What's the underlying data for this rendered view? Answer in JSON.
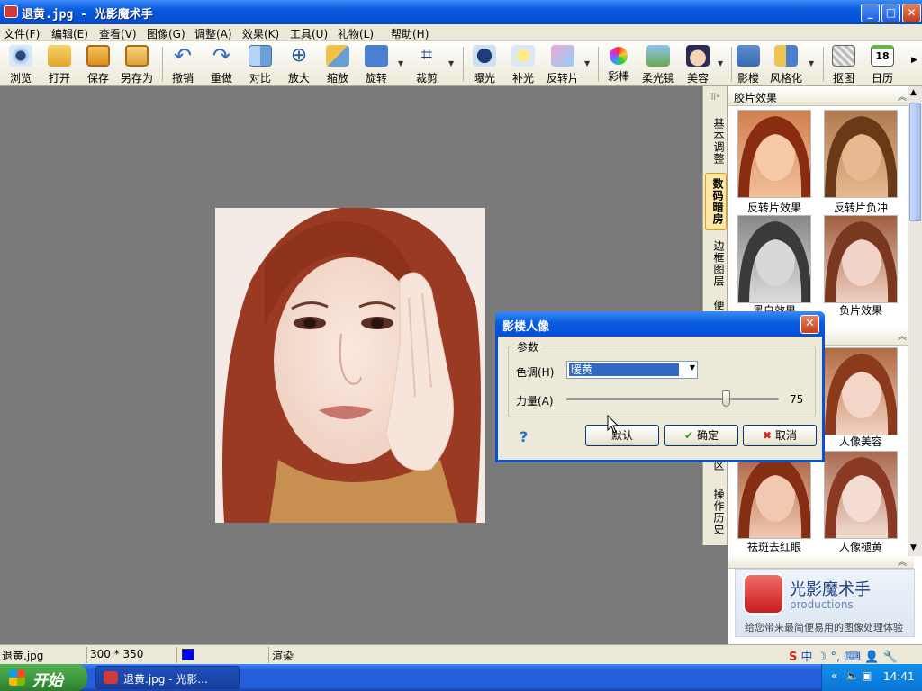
{
  "window": {
    "title": "退黄.jpg - 光影魔术手",
    "minimize": "_",
    "maximize": "□",
    "close": "✕"
  },
  "menu": [
    "文件(F)",
    "编辑(E)",
    "查看(V)",
    "图像(G)",
    "调整(A)",
    "效果(K)",
    "工具(U)",
    "礼物(L)",
    "帮助(H)"
  ],
  "toolbar": [
    "浏览",
    "打开",
    "保存",
    "另存为",
    "撤销",
    "重做",
    "对比",
    "放大",
    "缩放",
    "旋转",
    "裁剪",
    "曝光",
    "补光",
    "反转片",
    "彩棒",
    "柔光镜",
    "美容",
    "影楼",
    "风格化",
    "抠图",
    "日历"
  ],
  "calendar_day": "18",
  "side_tabs": [
    "基本调整",
    "数码暗房",
    "边框图层",
    "便",
    "区",
    "操作历史"
  ],
  "panel": {
    "section1": "胶片效果",
    "thumbs": [
      "反转片效果",
      "反转片负冲",
      "黑白效果",
      "负片效果",
      "人像美容",
      "祛斑去红眼",
      "人像褪黄"
    ]
  },
  "promo": {
    "name": "光影魔术手",
    "sub": "productions",
    "slogan": "给您带来最简便易用的图像处理体验"
  },
  "dialog": {
    "title": "影楼人像",
    "close": "✕",
    "group": "参数",
    "tone_label": "色调(H)",
    "tone_value": "暖黄",
    "strength_label": "力量(A)",
    "strength_value": "75",
    "strength_fraction": 0.75,
    "help": "?",
    "default_btn": "默认",
    "ok_btn": "确定",
    "cancel_btn": "取消"
  },
  "status": {
    "filename": "退黄.jpg",
    "size": "300 * 350",
    "action": "渲染",
    "color_swatch": "#0000ff"
  },
  "taskbar": {
    "start": "开始",
    "task": "退黄.jpg - 光影...",
    "time": "14:41"
  }
}
